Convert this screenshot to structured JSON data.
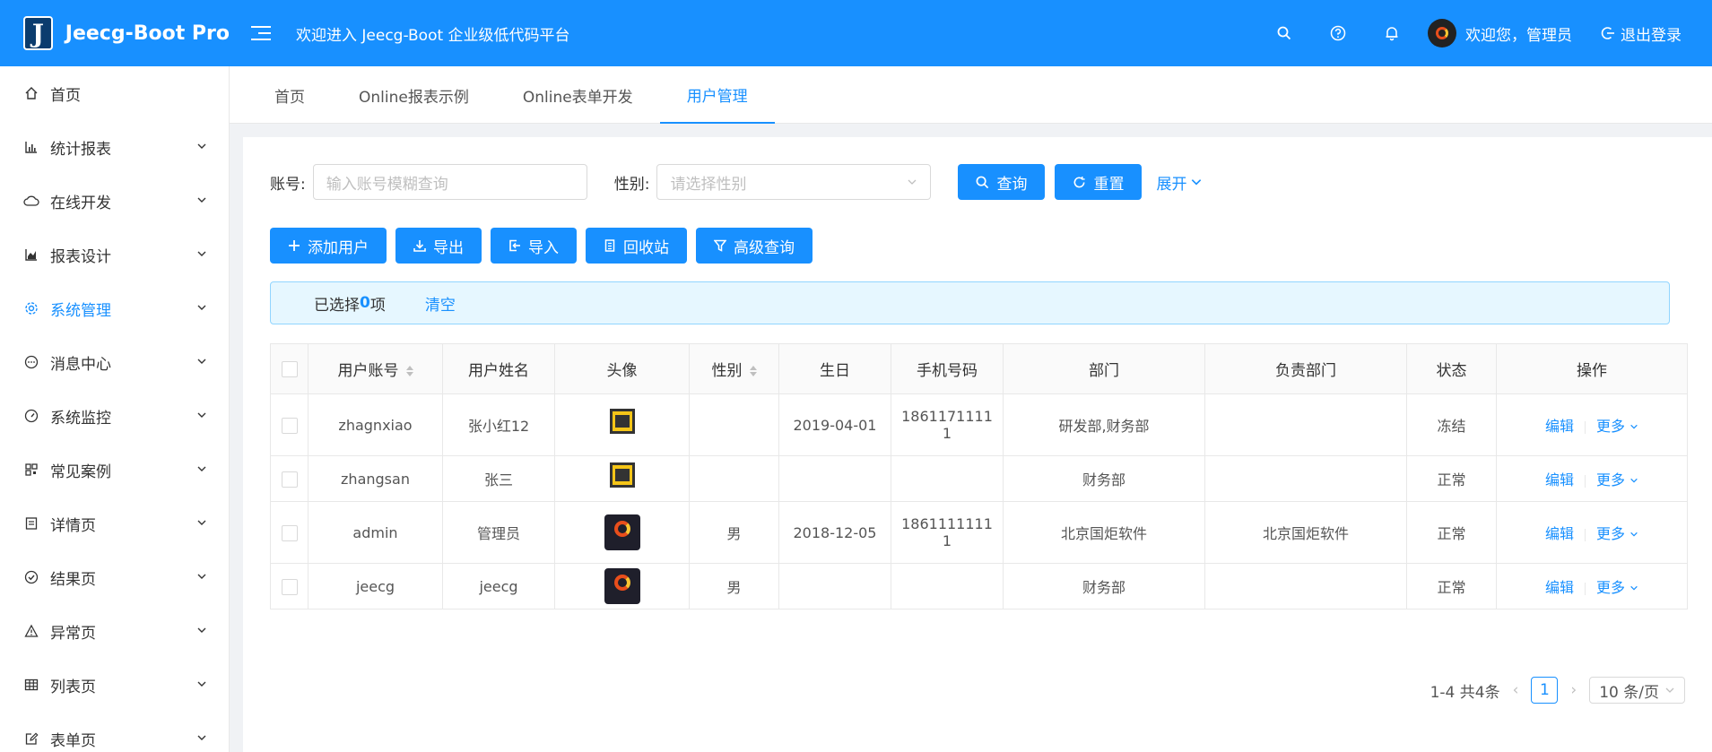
{
  "header": {
    "logo_text": "Jeecg-Boot Pro",
    "logo_letter": "J",
    "welcome": "欢迎进入 Jeecg-Boot 企业级低代码平台",
    "user_greeting": "欢迎您，管理员",
    "logout_label": "退出登录"
  },
  "sidebar": {
    "items": [
      {
        "label": "首页",
        "icon": "home-icon"
      },
      {
        "label": "统计报表",
        "icon": "bar-chart-icon"
      },
      {
        "label": "在线开发",
        "icon": "cloud-icon"
      },
      {
        "label": "报表设计",
        "icon": "area-chart-icon"
      },
      {
        "label": "系统管理",
        "icon": "setting-icon"
      },
      {
        "label": "消息中心",
        "icon": "message-icon"
      },
      {
        "label": "系统监控",
        "icon": "dashboard-icon"
      },
      {
        "label": "常见案例",
        "icon": "qrcode-icon"
      },
      {
        "label": "详情页",
        "icon": "profile-icon"
      },
      {
        "label": "结果页",
        "icon": "check-circle-icon"
      },
      {
        "label": "异常页",
        "icon": "warning-icon"
      },
      {
        "label": "列表页",
        "icon": "table-icon"
      },
      {
        "label": "表单页",
        "icon": "form-icon"
      }
    ]
  },
  "tabs": [
    {
      "label": "首页"
    },
    {
      "label": "Online报表示例"
    },
    {
      "label": "Online表单开发"
    },
    {
      "label": "用户管理"
    }
  ],
  "search": {
    "account_label": "账号:",
    "account_placeholder": "输入账号模糊查询",
    "gender_label": "性别:",
    "gender_placeholder": "请选择性别",
    "query_label": "查询",
    "reset_label": "重置",
    "expand_label": "展开"
  },
  "actions": {
    "add_label": "添加用户",
    "export_label": "导出",
    "import_label": "导入",
    "recycle_label": "回收站",
    "advanced_label": "高级查询"
  },
  "selection": {
    "prefix": "已选择",
    "count": "0",
    "suffix": "项",
    "clear_label": "清空"
  },
  "table": {
    "columns": [
      "用户账号",
      "用户姓名",
      "头像",
      "性别",
      "生日",
      "手机号码",
      "部门",
      "负责部门",
      "状态",
      "操作"
    ],
    "edit_label": "编辑",
    "more_label": "更多",
    "rows": [
      {
        "account": "zhagnxiao",
        "name": "张小红12",
        "avatar": "a",
        "gender": "",
        "birthday": "2019-04-01",
        "phone1": "1861171111",
        "phone2": "1",
        "dept": "研发部,财务部",
        "lead_dept": "",
        "status": "冻结"
      },
      {
        "account": "zhangsan",
        "name": "张三",
        "avatar": "a",
        "gender": "",
        "birthday": "",
        "phone1": "",
        "phone2": "",
        "dept": "财务部",
        "lead_dept": "",
        "status": "正常"
      },
      {
        "account": "admin",
        "name": "管理员",
        "avatar": "b",
        "gender": "男",
        "birthday": "2018-12-05",
        "phone1": "1861111111",
        "phone2": "1",
        "dept": "北京国炬软件",
        "lead_dept": "北京国炬软件",
        "status": "正常"
      },
      {
        "account": "jeecg",
        "name": "jeecg",
        "avatar": "b",
        "gender": "男",
        "birthday": "",
        "phone1": "",
        "phone2": "",
        "dept": "财务部",
        "lead_dept": "",
        "status": "正常"
      }
    ]
  },
  "pagination": {
    "total_text": "1-4 共4条",
    "current_page": "1",
    "page_size": "10 条/页"
  },
  "colors": {
    "primary": "#1890ff",
    "alert_bg": "#e6f7ff"
  }
}
